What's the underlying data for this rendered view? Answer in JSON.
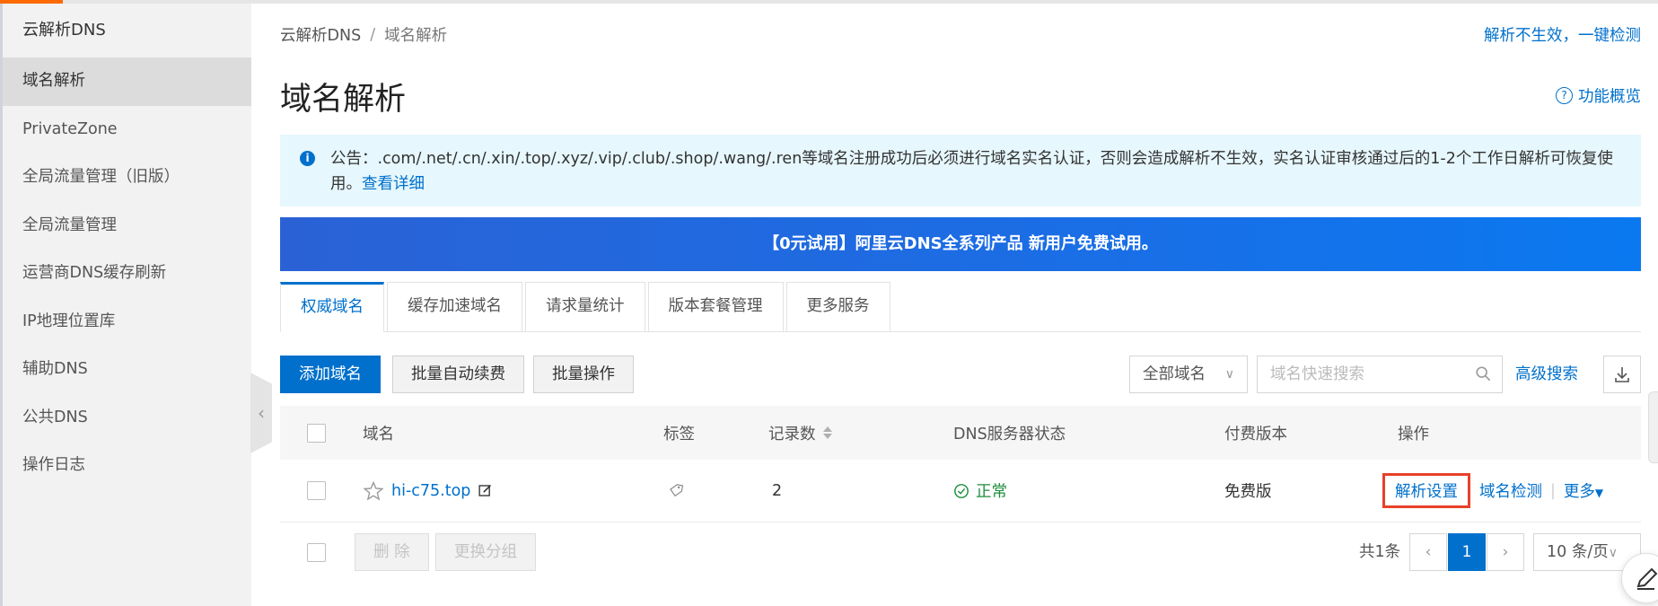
{
  "sidebar": {
    "title": "云解析DNS",
    "items": [
      {
        "label": "域名解析",
        "active": true
      },
      {
        "label": "PrivateZone"
      },
      {
        "label": "全局流量管理（旧版）"
      },
      {
        "label": "全局流量管理"
      },
      {
        "label": "运营商DNS缓存刷新"
      },
      {
        "label": "IP地理位置库"
      },
      {
        "label": "辅助DNS"
      },
      {
        "label": "公共DNS"
      },
      {
        "label": "操作日志"
      }
    ]
  },
  "breadcrumb": {
    "root": "云解析DNS",
    "sep": "/",
    "current": "域名解析"
  },
  "header": {
    "top_link": "解析不生效，一键检测",
    "title": "域名解析",
    "overview": "功能概览"
  },
  "notice": {
    "text": "公告：.com/.net/.cn/.xin/.top/.xyz/.vip/.club/.shop/.wang/.ren等域名注册成功后必须进行域名实名认证，否则会造成解析不生效，实名认证审核通过后的1-2个工作日解析可恢复使用。",
    "link": "查看详细"
  },
  "banner": {
    "text": "【0元试用】阿里云DNS全系列产品 新用户免费试用。"
  },
  "tabs": [
    "权威域名",
    "缓存加速域名",
    "请求量统计",
    "版本套餐管理",
    "更多服务"
  ],
  "toolbar": {
    "add": "添加域名",
    "auto_renew": "批量自动续费",
    "batch": "批量操作",
    "filter": "全部域名",
    "search_placeholder": "域名快速搜索",
    "advanced": "高级搜索"
  },
  "table": {
    "headers": {
      "domain": "域名",
      "tag": "标签",
      "records": "记录数",
      "dns_status": "DNS服务器状态",
      "edition": "付费版本",
      "actions": "操作"
    },
    "rows": [
      {
        "domain": "hi-c75.top",
        "records": "2",
        "dns_status": "正常",
        "edition": "免费版",
        "action_settings": "解析设置",
        "action_check": "域名检测",
        "action_more": "更多"
      }
    ]
  },
  "footer": {
    "delete": "删 除",
    "change_group": "更换分组",
    "total": "共1条",
    "current_page": "1",
    "page_size": "10 条/页"
  },
  "colors": {
    "accent": "#0070cc",
    "highlight": "#e8402a",
    "success": "#1e8e3e",
    "brand": "#ff6a00"
  }
}
